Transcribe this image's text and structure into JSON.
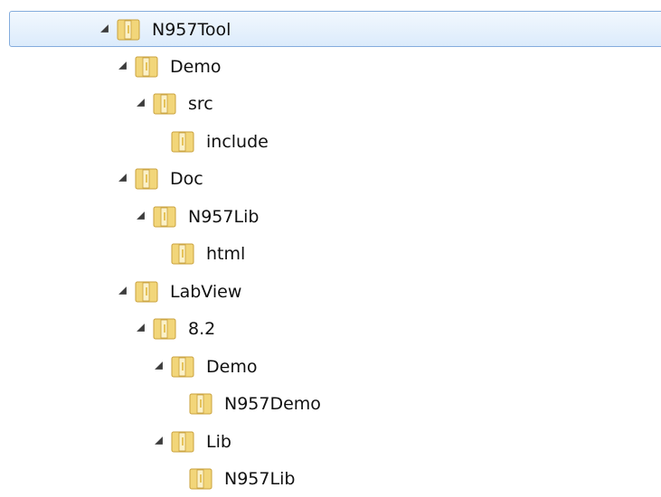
{
  "tree": {
    "nodes": [
      {
        "label": "N957Tool",
        "depth": 0,
        "expanded": true,
        "selected": true
      },
      {
        "label": "Demo",
        "depth": 1,
        "expanded": true,
        "selected": false
      },
      {
        "label": "src",
        "depth": 2,
        "expanded": true,
        "selected": false
      },
      {
        "label": "include",
        "depth": 3,
        "expanded": false,
        "selected": false
      },
      {
        "label": "Doc",
        "depth": 1,
        "expanded": true,
        "selected": false
      },
      {
        "label": "N957Lib",
        "depth": 2,
        "expanded": true,
        "selected": false
      },
      {
        "label": "html",
        "depth": 3,
        "expanded": false,
        "selected": false
      },
      {
        "label": "LabView",
        "depth": 1,
        "expanded": true,
        "selected": false
      },
      {
        "label": "8.2",
        "depth": 2,
        "expanded": true,
        "selected": false
      },
      {
        "label": "Demo",
        "depth": 3,
        "expanded": true,
        "selected": false
      },
      {
        "label": "N957Demo",
        "depth": 4,
        "expanded": false,
        "selected": false
      },
      {
        "label": "Lib",
        "depth": 3,
        "expanded": true,
        "selected": false
      },
      {
        "label": "N957Lib",
        "depth": 4,
        "expanded": false,
        "selected": false
      }
    ]
  },
  "icons": {
    "expander": "expanded-triangle-icon",
    "node": "folder-icon"
  },
  "colors": {
    "selection_border": "#84acdd",
    "selection_fill": "#dcebfb",
    "folder_body": "#f2d67a",
    "folder_edge": "#c9a13c",
    "arrow": "#3d3d3d"
  }
}
